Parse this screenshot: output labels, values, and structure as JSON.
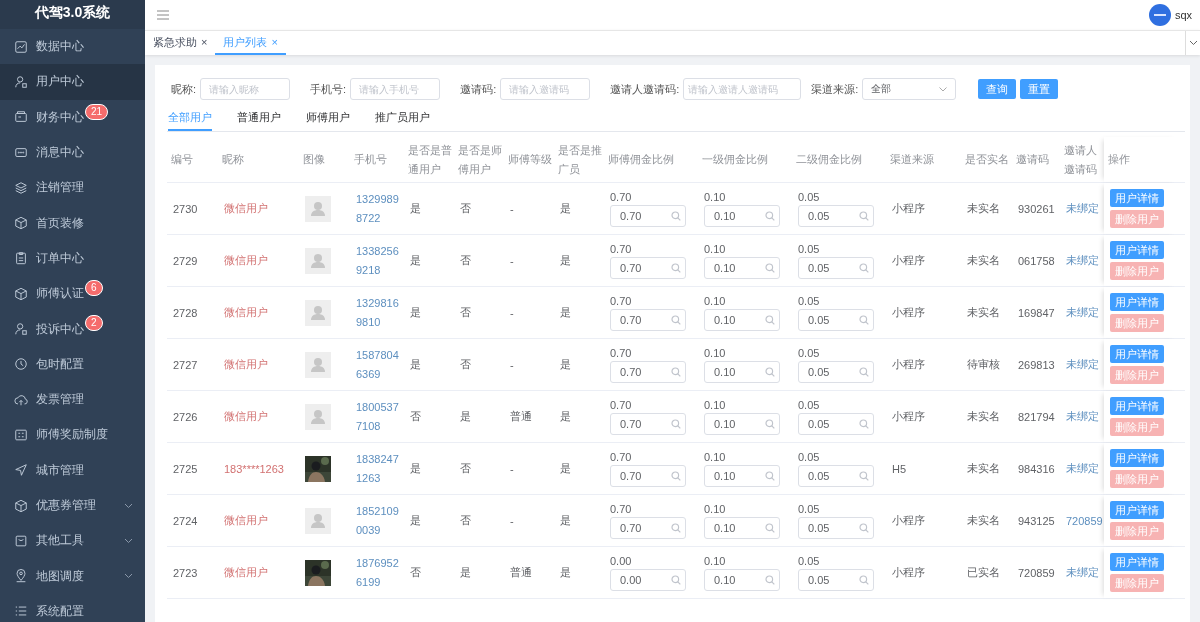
{
  "sidebar": {
    "title": "代驾3.0系统",
    "items": [
      {
        "label": "数据中心",
        "selected": false
      },
      {
        "label": "用户中心",
        "selected": true
      },
      {
        "label": "财务中心",
        "selected": false,
        "badge": "21"
      },
      {
        "label": "消息中心",
        "selected": false
      },
      {
        "label": "注销管理",
        "selected": false
      },
      {
        "label": "首页装修",
        "selected": false
      },
      {
        "label": "订单中心",
        "selected": false
      },
      {
        "label": "师傅认证",
        "selected": false,
        "badge": "6"
      },
      {
        "label": "投诉中心",
        "selected": false,
        "badge": "2"
      },
      {
        "label": "包时配置",
        "selected": false
      },
      {
        "label": "发票管理",
        "selected": false
      },
      {
        "label": "师傅奖励制度",
        "selected": false
      },
      {
        "label": "城市管理",
        "selected": false
      },
      {
        "label": "优惠券管理",
        "selected": false,
        "expandable": true
      },
      {
        "label": "其他工具",
        "selected": false,
        "expandable": true
      },
      {
        "label": "地图调度",
        "selected": false,
        "expandable": true
      },
      {
        "label": "系统配置",
        "selected": false
      }
    ]
  },
  "header": {
    "username": "sqx"
  },
  "page_tabs": [
    {
      "label": "紧急求助",
      "selected": false,
      "close": "×"
    },
    {
      "label": "用户列表",
      "selected": true,
      "close": "×"
    }
  ],
  "filters": [
    {
      "label": "昵称:",
      "placeholder": "请输入昵称",
      "kind": "input"
    },
    {
      "label": "手机号:",
      "placeholder": "请输入手机号",
      "kind": "input"
    },
    {
      "label": "邀请码:",
      "placeholder": "请输入邀请码",
      "kind": "input"
    },
    {
      "label": "邀请人邀请码:",
      "placeholder": "请输入邀请人邀请码",
      "kind": "input"
    },
    {
      "label": "渠道来源:",
      "value": "全部",
      "kind": "select"
    }
  ],
  "filter_buttons": [
    "查询",
    "重置"
  ],
  "user_tabs": [
    {
      "label": "全部用户",
      "selected": true
    },
    {
      "label": "普通用户",
      "selected": false
    },
    {
      "label": "师傅用户",
      "selected": false
    },
    {
      "label": "推广员用户",
      "selected": false
    }
  ],
  "table": {
    "columns": [
      "编号",
      "昵称",
      "图像",
      "手机号",
      "是否是普通用户",
      "是否是师傅用户",
      "师傅等级",
      "是否是推广员",
      "师傅佣金比例",
      "一级佣金比例",
      "二级佣金比例",
      "渠道来源",
      "是否实名",
      "邀请码",
      "邀请人邀请码",
      "操作"
    ],
    "rows": [
      {
        "id": "2730",
        "nickname": "微信用户",
        "has_photo": false,
        "phone": "13299898722",
        "normal": "是",
        "master": "否",
        "level": "-",
        "promoter": "是",
        "rates": [
          [
            "0.70",
            "0.70"
          ],
          [
            "0.10",
            "0.10"
          ],
          [
            "0.05",
            "0.05"
          ]
        ],
        "channel": "小程序",
        "realname": "未实名",
        "invite": "930261",
        "inviter": "未绑定",
        "actions": [
          "用户详情",
          "删除用户"
        ]
      },
      {
        "id": "2729",
        "nickname": "微信用户",
        "has_photo": false,
        "phone": "13382569218",
        "normal": "是",
        "master": "否",
        "level": "-",
        "promoter": "是",
        "rates": [
          [
            "0.70",
            "0.70"
          ],
          [
            "0.10",
            "0.10"
          ],
          [
            "0.05",
            "0.05"
          ]
        ],
        "channel": "小程序",
        "realname": "未实名",
        "invite": "061758",
        "inviter": "未绑定",
        "actions": [
          "用户详情",
          "删除用户"
        ]
      },
      {
        "id": "2728",
        "nickname": "微信用户",
        "has_photo": false,
        "phone": "13298169810",
        "normal": "是",
        "master": "否",
        "level": "-",
        "promoter": "是",
        "rates": [
          [
            "0.70",
            "0.70"
          ],
          [
            "0.10",
            "0.10"
          ],
          [
            "0.05",
            "0.05"
          ]
        ],
        "channel": "小程序",
        "realname": "未实名",
        "invite": "169847",
        "inviter": "未绑定",
        "actions": [
          "用户详情",
          "删除用户"
        ]
      },
      {
        "id": "2727",
        "nickname": "微信用户",
        "has_photo": false,
        "phone": "15878046369",
        "normal": "是",
        "master": "否",
        "level": "-",
        "promoter": "是",
        "rates": [
          [
            "0.70",
            "0.70"
          ],
          [
            "0.10",
            "0.10"
          ],
          [
            "0.05",
            "0.05"
          ]
        ],
        "channel": "小程序",
        "realname": "待审核",
        "invite": "269813",
        "inviter": "未绑定",
        "actions": [
          "用户详情",
          "删除用户"
        ]
      },
      {
        "id": "2726",
        "nickname": "微信用户",
        "has_photo": false,
        "phone": "18005377108",
        "normal": "否",
        "master": "是",
        "level": "普通",
        "promoter": "是",
        "rates": [
          [
            "0.70",
            "0.70"
          ],
          [
            "0.10",
            "0.10"
          ],
          [
            "0.05",
            "0.05"
          ]
        ],
        "channel": "小程序",
        "realname": "未实名",
        "invite": "821794",
        "inviter": "未绑定",
        "actions": [
          "用户详情",
          "删除用户"
        ]
      },
      {
        "id": "2725",
        "nickname": "183****1263",
        "has_photo": true,
        "phone": "18382471263",
        "normal": "是",
        "master": "否",
        "level": "-",
        "promoter": "是",
        "rates": [
          [
            "0.70",
            "0.70"
          ],
          [
            "0.10",
            "0.10"
          ],
          [
            "0.05",
            "0.05"
          ]
        ],
        "channel": "H5",
        "realname": "未实名",
        "invite": "984316",
        "inviter": "未绑定",
        "actions": [
          "用户详情",
          "删除用户"
        ]
      },
      {
        "id": "2724",
        "nickname": "微信用户",
        "has_photo": false,
        "phone": "18521090039",
        "normal": "是",
        "master": "否",
        "level": "-",
        "promoter": "是",
        "rates": [
          [
            "0.70",
            "0.70"
          ],
          [
            "0.10",
            "0.10"
          ],
          [
            "0.05",
            "0.05"
          ]
        ],
        "channel": "小程序",
        "realname": "未实名",
        "invite": "943125",
        "inviter": "720859",
        "actions": [
          "用户详情",
          "删除用户"
        ]
      },
      {
        "id": "2723",
        "nickname": "微信用户",
        "has_photo": true,
        "phone": "18769526199",
        "normal": "否",
        "master": "是",
        "level": "普通",
        "promoter": "是",
        "rates": [
          [
            "0.00",
            "0.00"
          ],
          [
            "0.10",
            "0.10"
          ],
          [
            "0.05",
            "0.05"
          ]
        ],
        "channel": "小程序",
        "realname": "已实名",
        "invite": "720859",
        "inviter": "未绑定",
        "actions": [
          "用户详情",
          "删除用户"
        ]
      }
    ]
  }
}
